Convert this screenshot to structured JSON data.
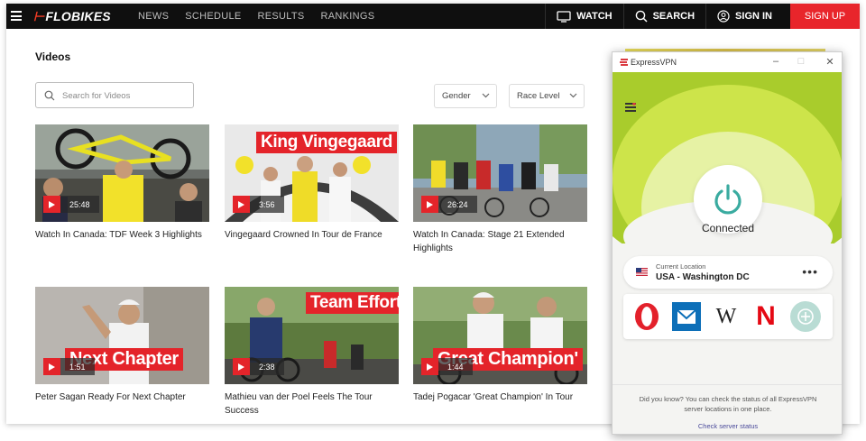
{
  "nav": {
    "logo_mark": "⊢",
    "logo_text": "FLOBIKES",
    "links": [
      "NEWS",
      "SCHEDULE",
      "RESULTS",
      "RANKINGS"
    ],
    "watch_label": "WATCH",
    "search_label": "SEARCH",
    "signin_label": "SIGN IN",
    "signup_label": "SIGN UP"
  },
  "videos": {
    "heading": "Videos",
    "search_placeholder": "Search for Videos",
    "filters": [
      "Gender",
      "Race Level"
    ],
    "items": [
      {
        "title": "Watch In Canada: TDF Week 3 Highlights",
        "duration": "25:48",
        "banner": ""
      },
      {
        "title": "Vingegaard Crowned In Tour de France",
        "duration": "3:56",
        "banner": "King Vingegaard"
      },
      {
        "title": "Watch In Canada: Stage 21 Extended Highlights",
        "duration": "26:24",
        "banner": ""
      },
      {
        "title": "Peter Sagan Ready For Next Chapter",
        "duration": "1:51",
        "banner": "Next Chapter"
      },
      {
        "title": "Mathieu van der Poel Feels The Tour Success",
        "duration": "2:38",
        "banner": "Team Effort"
      },
      {
        "title": "Tadej Pogacar 'Great Champion' In Tour",
        "duration": "1:44",
        "banner": "Great Champion'"
      }
    ]
  },
  "vpn": {
    "app_title": "ExpressVPN",
    "status": "Connected",
    "location_label": "Current Location",
    "location_value": "USA - Washington DC",
    "more": "•••",
    "shortcut_icons": [
      "opera-icon",
      "mail-icon",
      "wikipedia-icon",
      "netflix-icon",
      "add-shortcut-icon"
    ],
    "wiki_glyph": "W",
    "netflix_glyph": "N",
    "tip_text": "Did you know? You can check the status of all ExpressVPN server locations in one place.",
    "tip_link": "Check server status",
    "colors": {
      "accent": "#aed02a",
      "power": "#3aaba0"
    }
  }
}
